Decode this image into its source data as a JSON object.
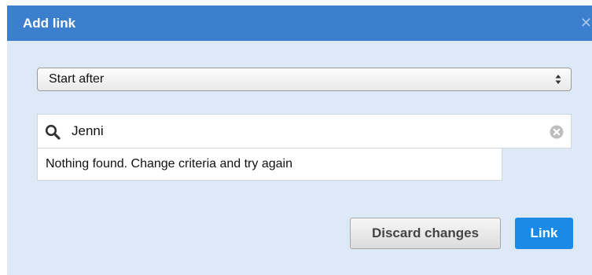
{
  "dialog": {
    "title": "Add link",
    "close_icon": "close-icon",
    "colors": {
      "titlebar": "#3c7fce",
      "body": "#dde9f6",
      "primary_button": "#1a8ae6"
    }
  },
  "type_select": {
    "value": "Start after",
    "icon": "select-arrows-icon"
  },
  "search": {
    "value": "Jenni",
    "icon": "search-icon",
    "clear_icon": "clear-icon"
  },
  "results": {
    "message": "Nothing found. Change criteria and try again"
  },
  "actions": {
    "discard_label": "Discard changes",
    "link_label": "Link"
  }
}
